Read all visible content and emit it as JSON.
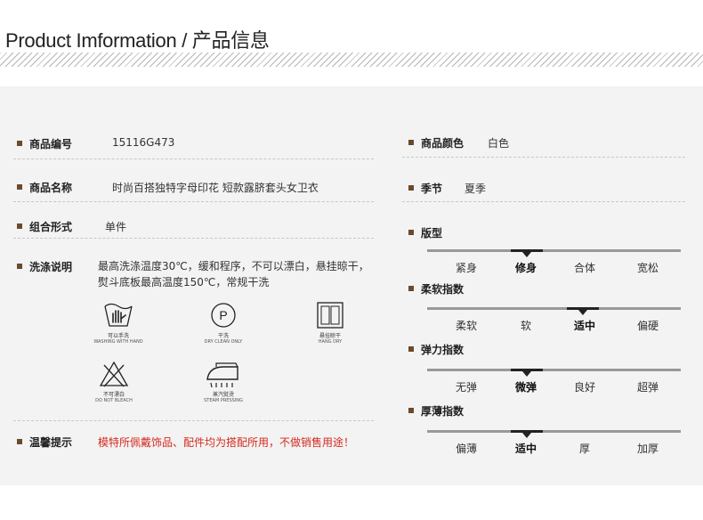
{
  "header": {
    "title": "Product Imformation / 产品信息"
  },
  "left": {
    "code_label": "商品编号",
    "code_value": "15116G473",
    "name_label": "商品名称",
    "name_value": "时尚百搭独特字母印花 短款露脐套头女卫衣",
    "combo_label": "组合形式",
    "combo_value": "单件",
    "wash_label": "洗涤说明",
    "wash_line1": "最高洗涤温度30℃，缓和程序，不可以漂白，悬挂晾干，",
    "wash_line2": "熨斗底板最高温度150℃，常规干洗",
    "care": [
      {
        "cn": "可以手洗",
        "en": "WASHING WITH HAND",
        "icon": "hand-wash-icon"
      },
      {
        "cn": "干洗",
        "en": "DRY CLEAN ONLY",
        "icon": "dry-clean-icon"
      },
      {
        "cn": "悬挂晾干",
        "en": "HANG DRY",
        "icon": "hang-dry-icon"
      },
      {
        "cn": "不可漂白",
        "en": "DO NOT BLEACH",
        "icon": "no-bleach-icon"
      },
      {
        "cn": "蒸汽熨烫",
        "en": "STEAM PRESSING",
        "icon": "steam-iron-icon"
      }
    ],
    "dry_clean_letter": "P",
    "tip_label": "温馨提示",
    "tip_value": "模特所佩戴饰品、配件均为搭配所用，不做销售用途！"
  },
  "right": {
    "color_label": "商品颜色",
    "color_value": "白色",
    "season_label": "季节",
    "season_value": "夏季",
    "fit": {
      "label": "版型",
      "options": [
        "紧身",
        "修身",
        "合体",
        "宽松"
      ],
      "selected": 1
    },
    "soft": {
      "label": "柔软指数",
      "options": [
        "柔软",
        "软",
        "适中",
        "偏硬"
      ],
      "selected": 2
    },
    "elastic": {
      "label": "弹力指数",
      "options": [
        "无弹",
        "微弹",
        "良好",
        "超弹"
      ],
      "selected": 1
    },
    "thick": {
      "label": "厚薄指数",
      "options": [
        "偏薄",
        "适中",
        "厚",
        "加厚"
      ],
      "selected": 1
    }
  },
  "colors": {
    "bullet": "#6b4a2b",
    "warning": "#d42a1f",
    "panel": "#f3f3f3"
  }
}
